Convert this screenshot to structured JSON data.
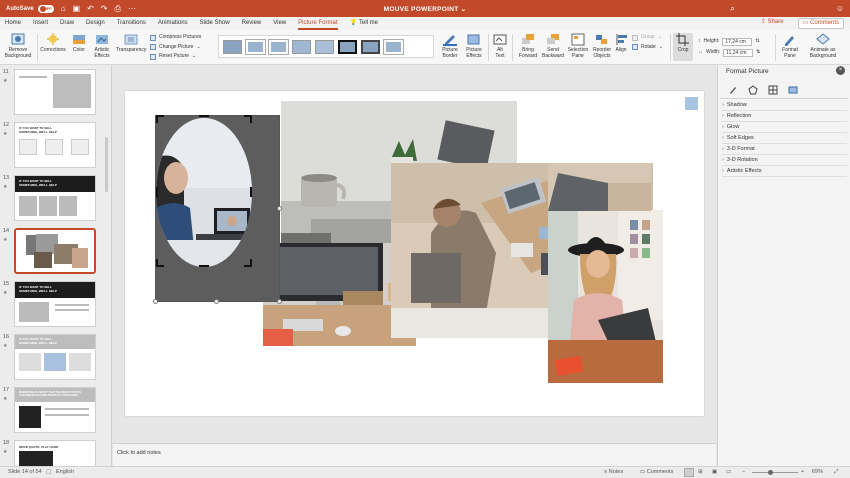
{
  "titlebar": {
    "autosave_label": "AutoSave",
    "toggle_state": "OFF",
    "doc_title": "MOUVE POWERPOINT"
  },
  "tabs": [
    {
      "label": "Home"
    },
    {
      "label": "Insert"
    },
    {
      "label": "Draw"
    },
    {
      "label": "Design"
    },
    {
      "label": "Transitions"
    },
    {
      "label": "Animations"
    },
    {
      "label": "Slide Show"
    },
    {
      "label": "Review"
    },
    {
      "label": "View"
    },
    {
      "label": "Picture Format"
    },
    {
      "label": "Tell me"
    }
  ],
  "share_label": "Share",
  "comments_label": "Comments",
  "ribbon": {
    "remove_bg": "Remove\nBackground",
    "corrections": "Corrections",
    "color": "Color",
    "artistic": "Artistic\nEffects",
    "transparency": "Transparency",
    "compress": "Compress Pictures",
    "change": "Change Picture",
    "reset": "Reset Picture",
    "picture_border": "Picture\nBorder",
    "picture_effects": "Picture\nEffects",
    "alt_text": "Alt\nText",
    "bring_forward": "Bring\nForward",
    "send_backward": "Send\nBackward",
    "selection_pane": "Selection\nPane",
    "reorder": "Reorder\nObjects",
    "align": "Align",
    "group": "Group",
    "rotate": "Rotate",
    "crop": "Crop",
    "height_label": "Height:",
    "height_value": "17,24 cm",
    "width_label": "Width:",
    "width_value": "11,24 cm",
    "format_pane": "Format\nPane",
    "animate_bg": "Animate as\nBackground"
  },
  "slides": [
    {
      "num": "11"
    },
    {
      "num": "12"
    },
    {
      "num": "13"
    },
    {
      "num": "14"
    },
    {
      "num": "15"
    },
    {
      "num": "16"
    },
    {
      "num": "17"
    },
    {
      "num": "18"
    }
  ],
  "slide_texts": {
    "t12": "IF YOU WANT TO SELL\nSOMETHING, WE'LL HELP",
    "t18": "MOVE QUOTE, PLAY HARD",
    "t17": "MARKETING IS ABOUT THAT THE RESULTS WITH\nCUSTOMER-FOCUSED PRODUCT STRATEGIES"
  },
  "notes_placeholder": "Click to add notes",
  "pane": {
    "title": "Format Picture",
    "sections": [
      "Shadow",
      "Reflection",
      "Glow",
      "Soft Edges",
      "3-D Format",
      "3-D Rotation",
      "Artistic Effects"
    ]
  },
  "status": {
    "slide_info": "Slide 14 of 54",
    "language": "English",
    "notes": "Notes",
    "comments": "Comments",
    "zoom": "69%"
  }
}
